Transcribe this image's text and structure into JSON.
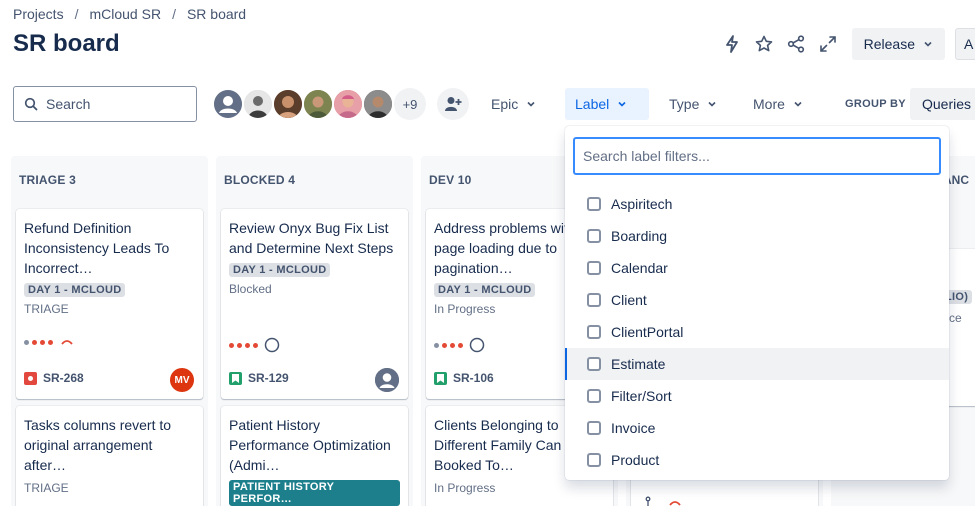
{
  "breadcrumb": {
    "items": [
      "Projects",
      "mCloud SR",
      "SR board"
    ]
  },
  "page_title": "SR board",
  "top_actions": {
    "release_label": "Release",
    "a_label": "A"
  },
  "filter_bar": {
    "search_placeholder": "Search",
    "avatars_more": "+9",
    "epic_label": "Epic",
    "label_label": "Label",
    "type_label": "Type",
    "more_label": "More",
    "group_by_label": "GROUP BY",
    "queries_label": "Queries"
  },
  "columns": [
    {
      "header": "TRIAGE 3",
      "cards": [
        {
          "title": "Refund Definition Inconsistency Leads To Incorrect…",
          "epic": "DAY 1 - MCLOUD",
          "status": "TRIAGE",
          "key": "SR-268",
          "assignee_initials": "MV"
        },
        {
          "title": "Tasks columns revert to original arrangement after…",
          "status": "TRIAGE"
        }
      ]
    },
    {
      "header": "BLOCKED 4",
      "cards": [
        {
          "title": "Review Onyx Bug Fix List and Determine Next Steps",
          "epic": "DAY 1 - MCLOUD",
          "status": "Blocked",
          "key": "SR-129"
        },
        {
          "title": "Patient History Performance Optimization (Admi…",
          "epic": "PATIENT HISTORY PERFOR…"
        }
      ]
    },
    {
      "header": "DEV 10",
      "cards": [
        {
          "title": "Address problems with page loading due to pagination…",
          "epic": "DAY 1 - MCLOUD",
          "status": "In Progress",
          "key": "SR-106"
        },
        {
          "title": "Clients Belonging to Different Family Can Be Booked To…",
          "status": "In Progress"
        }
      ]
    }
  ],
  "right_partial": {
    "header": "ANC",
    "tag": "LIO)",
    "text": "ce"
  },
  "label_dropdown": {
    "search_placeholder": "Search label filters...",
    "options": [
      "Aspiritech",
      "Boarding",
      "Calendar",
      "Client",
      "ClientPortal",
      "Estimate",
      "Filter/Sort",
      "Invoice",
      "Product"
    ]
  },
  "colors": {
    "accent": "#0c66e4",
    "priority": "#e34935",
    "teal_tag": "#1d7f8c",
    "story": "#22a06b",
    "bug": "#e2483d"
  }
}
